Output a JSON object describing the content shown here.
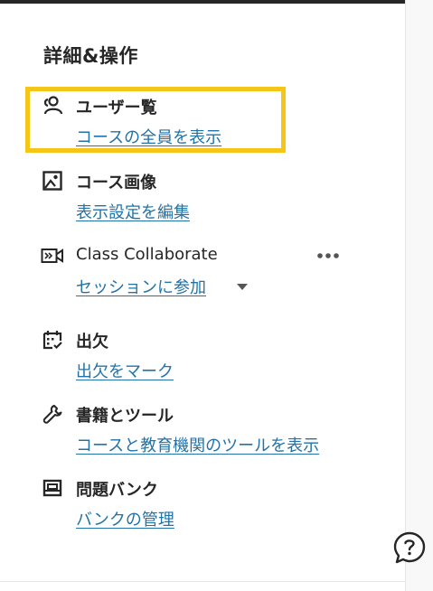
{
  "panel": {
    "title": "詳細&操作",
    "items": [
      {
        "label": "ユーザー覧",
        "link": "コースの全員を表示",
        "icon": "users-icon"
      },
      {
        "label": "コース画像",
        "link": "表示設定を編集",
        "icon": "image-icon"
      },
      {
        "label": "Class Collaborate",
        "link": "セッションに参加",
        "icon": "video-icon"
      },
      {
        "label": "出欠",
        "link": "出欠をマーク",
        "icon": "calendar-check-icon"
      },
      {
        "label": "書籍とツール",
        "link": "コースと教育機関のツールを表示",
        "icon": "wrench-icon"
      },
      {
        "label": "問題バンク",
        "link": "バンクの管理",
        "icon": "question-bank-icon"
      }
    ]
  },
  "colors": {
    "link": "#2173a8",
    "text": "#262626",
    "highlight": "#f5c518"
  }
}
